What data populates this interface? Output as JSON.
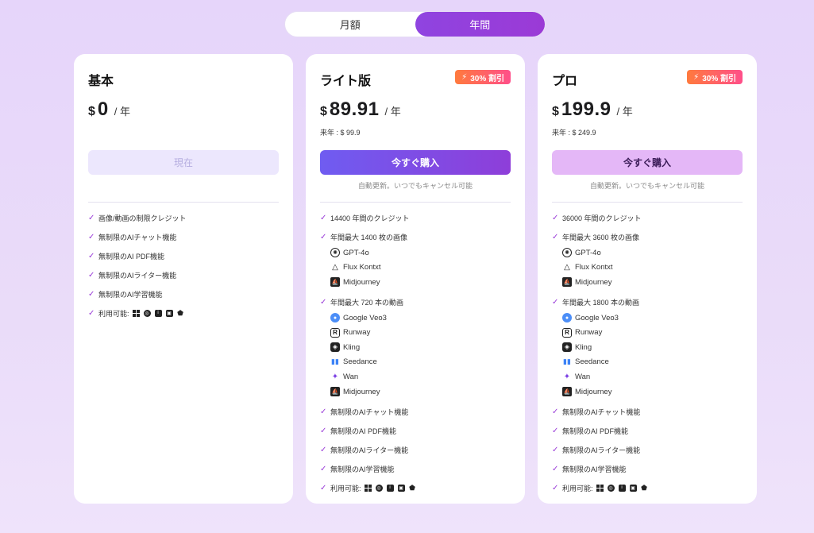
{
  "billing_toggle": {
    "monthly_label": "月額",
    "yearly_label": "年間",
    "selected": "yearly"
  },
  "colors": {
    "accent": "#9b3ad6",
    "badge_start": "#ff7a3d",
    "badge_end": "#ff4f8a",
    "check": "#9a3dd8"
  },
  "plans": {
    "basic": {
      "title": "基本",
      "currency": "$",
      "price": "0",
      "period": "/ 年",
      "button_label": "現在",
      "features": [
        "画像/動画の制限クレジット",
        "無制限のAIチャット機能",
        "無制限のAI PDF機能",
        "無制限のAIライター機能",
        "無制限のAI学習機能"
      ],
      "platforms_label": "利用可能:"
    },
    "lite": {
      "title": "ライト版",
      "badge": "30% 割引",
      "currency": "$",
      "price": "89.91",
      "period": "/ 年",
      "prev_price": "来年 : $ 99.9",
      "button_label": "今すぐ購入",
      "renew_note": "自動更新。いつでもキャンセル可能",
      "credits": "14400 年間のクレジット",
      "images": "年間最大 1400 枚の画像",
      "image_models": [
        "GPT-4o",
        "Flux Kontxt",
        "Midjourney"
      ],
      "videos": "年間最大 720 本の動画",
      "video_models": [
        "Google Veo3",
        "Runway",
        "Kling",
        "Seedance",
        "Wan",
        "Midjourney"
      ],
      "features": [
        "無制限のAIチャット機能",
        "無制限のAI PDF機能",
        "無制限のAIライター機能",
        "無制限のAI学習機能"
      ],
      "platforms_label": "利用可能:"
    },
    "pro": {
      "title": "プロ",
      "badge": "30% 割引",
      "currency": "$",
      "price": "199.9",
      "period": "/ 年",
      "prev_price": "来年 : $ 249.9",
      "button_label": "今すぐ購入",
      "renew_note": "自動更新。いつでもキャンセル可能",
      "credits": "36000 年間のクレジット",
      "images": "年間最大 3600 枚の画像",
      "image_models": [
        "GPT-4o",
        "Flux Kontxt",
        "Midjourney"
      ],
      "videos": "年間最大 1800 本の動画",
      "video_models": [
        "Google Veo3",
        "Runway",
        "Kling",
        "Seedance",
        "Wan",
        "Midjourney"
      ],
      "features": [
        "無制限のAIチャット機能",
        "無制限のAI PDF機能",
        "無制限のAIライター機能",
        "無制限のAI学習機能"
      ],
      "platforms_label": "利用可能:"
    }
  },
  "platform_icons": [
    "windows-icon",
    "macos-icon",
    "ios-icon",
    "web-app-icon",
    "android-icon"
  ]
}
